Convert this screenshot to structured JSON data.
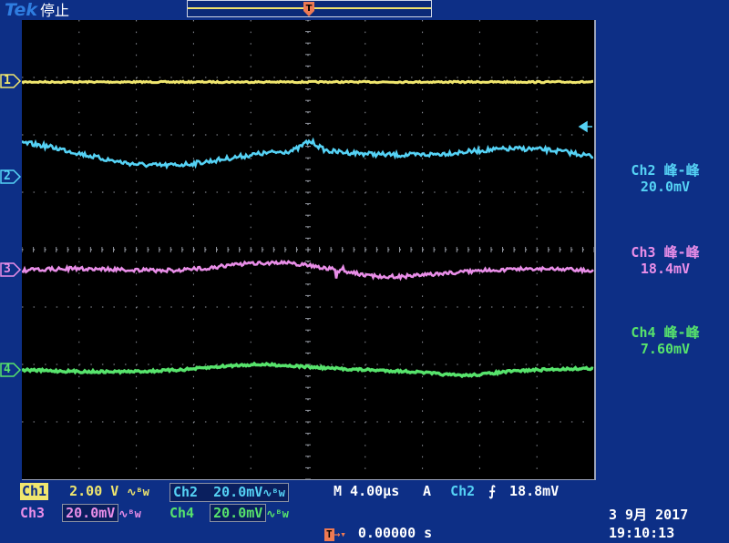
{
  "header": {
    "brand": "Tek",
    "run_state": "停止"
  },
  "colors": {
    "ch1": "#f0e66e",
    "ch2": "#55d2f5",
    "ch3": "#e98ee8",
    "ch4": "#57e36c",
    "trigger": "#ee7a53",
    "background": "#0d2f86",
    "grid": "#000000",
    "gridline": "#8f939c"
  },
  "channels": [
    {
      "id": "1",
      "label": "1"
    },
    {
      "id": "2",
      "label": "2"
    },
    {
      "id": "3",
      "label": "3"
    },
    {
      "id": "4",
      "label": "4"
    }
  ],
  "measurements": [
    {
      "channel": "Ch2",
      "name": "峰-峰",
      "value": "20.0mV"
    },
    {
      "channel": "Ch3",
      "name": "峰-峰",
      "value": "18.4mV"
    },
    {
      "channel": "Ch4",
      "name": "峰-峰",
      "value": "7.60mV"
    }
  ],
  "readout": {
    "ch1": {
      "label": "Ch1",
      "scale": "2.00 V",
      "coupling": "∿ᴮw"
    },
    "ch2": {
      "label": "Ch2",
      "scale": "20.0mV",
      "coupling": "∿ᴮw"
    },
    "ch3": {
      "label": "Ch3",
      "scale": "20.0mV",
      "coupling": "∿ᴮw"
    },
    "ch4": {
      "label": "Ch4",
      "scale": "20.0mV",
      "coupling": "∿ᴮw"
    },
    "timebase": "M 4.00µs",
    "trigger": {
      "mode": "A",
      "source": "Ch2",
      "slope": "⨍",
      "level": "18.8mV"
    },
    "position": "0.00000 s",
    "date": "3 9月  2017",
    "time": "19:10:13"
  }
}
